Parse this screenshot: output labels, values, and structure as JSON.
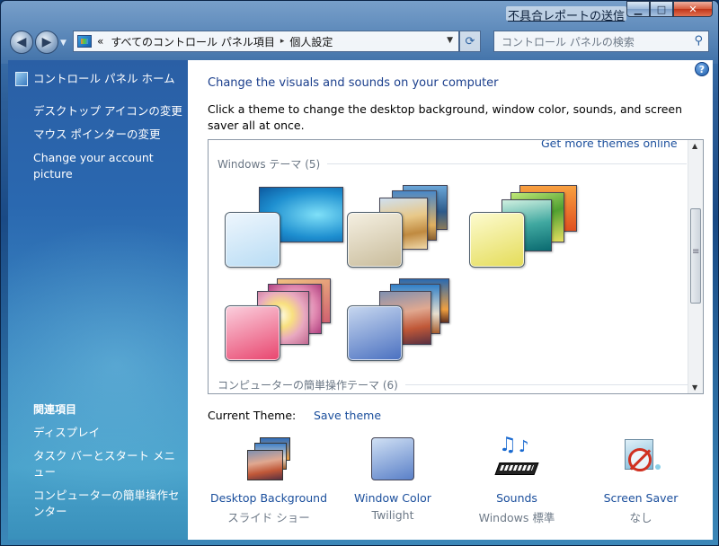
{
  "window": {
    "report_link": "不具合レポートの送信",
    "caption": {
      "minimize": "▁",
      "maximize": "□",
      "close": "✕"
    }
  },
  "nav": {
    "back": "◀",
    "forward": "▶",
    "breadcrumb_prefix": "«",
    "crumb_1": "すべてのコントロール パネル項目",
    "crumb_sep": "▸",
    "crumb_2": "個人設定",
    "refresh": "⟳",
    "search_placeholder": "コントロール パネルの検索",
    "search_icon": "🔍"
  },
  "sidebar": {
    "home": "コントロール パネル ホーム",
    "links": [
      "デスクトップ アイコンの変更",
      "マウス ポインターの変更",
      "Change your account picture"
    ],
    "related_heading": "関連項目",
    "related": [
      "ディスプレイ",
      "タスク バーとスタート メニュー",
      "コンピューターの簡単操作センター"
    ]
  },
  "main": {
    "help": "?",
    "title": "Change the visuals and sounds on your computer",
    "description": "Click a theme to change the desktop background, window color, sounds, and screen saver all at once.",
    "get_more": "Get more themes online",
    "group_windows": "Windows テーマ (5)",
    "group_ease": "コンピューターの簡単操作テーマ (6)",
    "current_theme_label": "Current Theme:",
    "save_theme": "Save theme",
    "bottom": [
      {
        "label": "Desktop Background",
        "value": "スライド ショー"
      },
      {
        "label": "Window Color",
        "value": "Twilight"
      },
      {
        "label": "Sounds",
        "value": "Windows 標準"
      },
      {
        "label": "Screen Saver",
        "value": "なし"
      }
    ]
  }
}
